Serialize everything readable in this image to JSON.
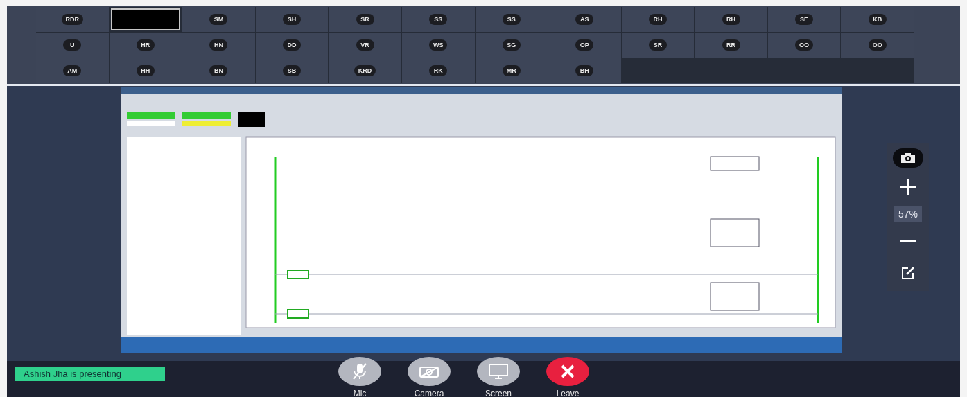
{
  "participants": [
    {
      "initials": "RDR",
      "video_on": false
    },
    {
      "video_on": true
    },
    {
      "initials": "SM",
      "video_on": false
    },
    {
      "initials": "SH",
      "video_on": false
    },
    {
      "initials": "SR",
      "video_on": false
    },
    {
      "initials": "SS",
      "video_on": false
    },
    {
      "initials": "SS",
      "video_on": false
    },
    {
      "initials": "AS",
      "video_on": false
    },
    {
      "initials": "RH",
      "video_on": false
    },
    {
      "initials": "RH",
      "video_on": false
    },
    {
      "initials": "SE",
      "video_on": false
    },
    {
      "initials": "KB",
      "video_on": false
    },
    {
      "initials": "U",
      "video_on": false
    },
    {
      "initials": "HR",
      "video_on": false
    },
    {
      "initials": "HN",
      "video_on": false
    },
    {
      "initials": "DD",
      "video_on": false
    },
    {
      "initials": "VR",
      "video_on": false
    },
    {
      "initials": "WS",
      "video_on": false
    },
    {
      "initials": "SG",
      "video_on": false
    },
    {
      "initials": "OP",
      "video_on": false
    },
    {
      "initials": "SR",
      "video_on": false
    },
    {
      "initials": "RR",
      "video_on": false
    },
    {
      "initials": "OO",
      "video_on": false
    },
    {
      "initials": "OO",
      "video_on": false
    },
    {
      "initials": "AM",
      "video_on": false
    },
    {
      "initials": "HH",
      "video_on": false
    },
    {
      "initials": "BN",
      "video_on": false
    },
    {
      "initials": "SB",
      "video_on": false
    },
    {
      "initials": "KRD",
      "video_on": false
    },
    {
      "initials": "RK",
      "video_on": false
    },
    {
      "initials": "MR",
      "video_on": false
    },
    {
      "initials": "BH",
      "video_on": false
    }
  ],
  "zoom_controls": {
    "level_text": "57%"
  },
  "presenter_banner": "Ashish Jha is presenting",
  "call_controls": [
    {
      "kind": "mic",
      "label": "Mic"
    },
    {
      "kind": "camera",
      "label": "Camera"
    },
    {
      "kind": "screen",
      "label": "Screen"
    },
    {
      "kind": "leave",
      "label": "Leave"
    }
  ]
}
